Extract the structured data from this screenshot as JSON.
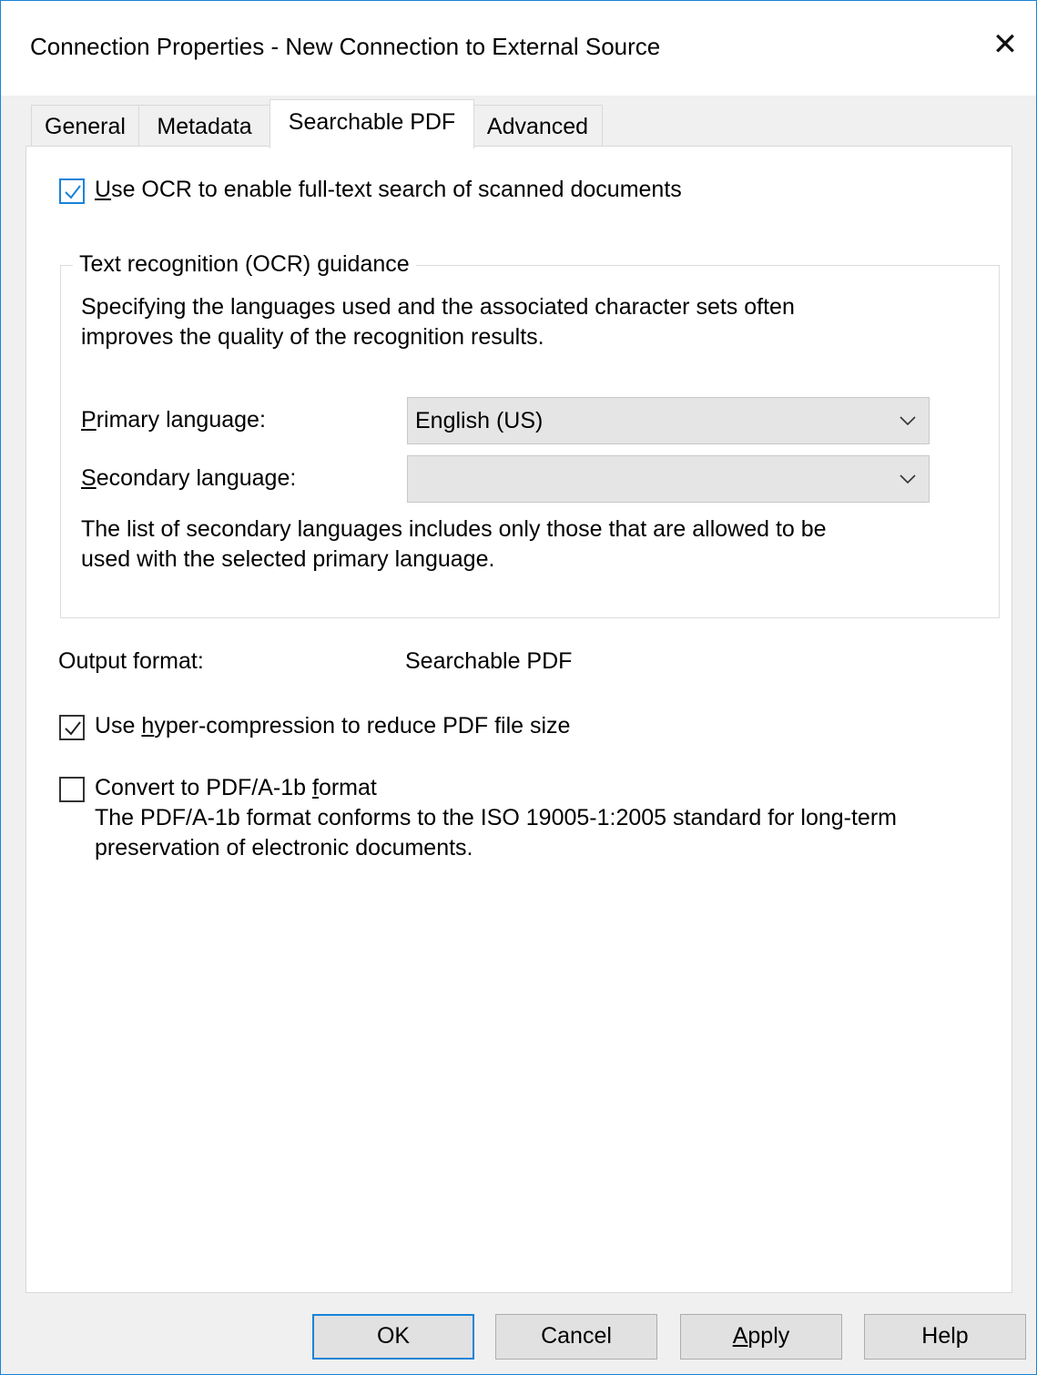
{
  "window": {
    "title": "Connection Properties - New Connection to External Source",
    "close_glyph": "✕",
    "accent_color": "#1883d7"
  },
  "tabs": [
    {
      "label": "General",
      "active": false
    },
    {
      "label": "Metadata",
      "active": false
    },
    {
      "label": "Searchable PDF",
      "active": true
    },
    {
      "label": "Advanced",
      "active": false
    }
  ],
  "ocr_option": {
    "checked": true,
    "label_pre": "",
    "label_u": "U",
    "label_post": "se OCR to enable full-text search of scanned documents"
  },
  "guidance_group": {
    "title": "Text recognition (OCR) guidance",
    "description_line1": "Specifying the languages used and the associated character sets often",
    "description_line2": "improves the quality of the recognition results.",
    "primary_label_u": "P",
    "primary_label_rest": "rimary language:",
    "primary_value": "English (US)",
    "secondary_label_u": "S",
    "secondary_label_rest": "econdary language:",
    "secondary_value": "",
    "note_line1": "The list of secondary languages includes only those that are allowed to be",
    "note_line2": "used with the selected primary language."
  },
  "output_format": {
    "label": "Output format:",
    "value": "Searchable PDF"
  },
  "hyper_compression": {
    "checked": true,
    "label_pre": "Use ",
    "label_u": "h",
    "label_post": "yper-compression to reduce PDF file size"
  },
  "pdfa": {
    "checked": false,
    "label_pre": "Convert to PDF/A-1b ",
    "label_u": "f",
    "label_post": "ormat",
    "description_line1": "The PDF/A-1b format conforms to the ISO 19005-1:2005 standard for long-term",
    "description_line2": "preservation of electronic documents."
  },
  "buttons": {
    "ok": "OK",
    "cancel": "Cancel",
    "apply_u": "A",
    "apply_rest": "pply",
    "help": "Help"
  }
}
